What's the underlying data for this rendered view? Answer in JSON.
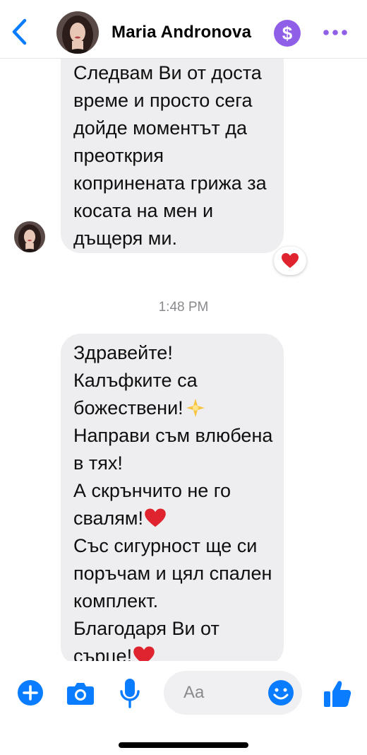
{
  "header": {
    "back_icon": "chevron-left-icon",
    "contact_name": "Maria Andronova",
    "badge_symbol": "$",
    "more_icon": "ellipsis-icon"
  },
  "messages": {
    "first": {
      "lines": [
        "Следвам Ви от доста",
        "време и просто сега",
        "дойде моментът да",
        "преоткрия",
        "копринената грижа за",
        "косата на мен и",
        "дъщеря ми."
      ],
      "reaction": "heart"
    },
    "timestamp": "1:48 PM",
    "second": {
      "lines": [
        "Здравейте!",
        "Калъфките са",
        "божествени!",
        "Направи съм влюбена",
        "в тях!",
        "А скрънчито не го",
        "свалям!",
        "Със сигурност ще си",
        "поръчам и цял спален",
        "комплект.",
        "Благодаря Ви от",
        "сърце!"
      ]
    }
  },
  "composer": {
    "placeholder": "Aa",
    "icons": [
      "plus-icon",
      "camera-icon",
      "microphone-icon",
      "emoji-icon",
      "thumbs-up-icon"
    ]
  },
  "colors": {
    "accent": "#0a7cff",
    "bubble": "#eeeef0",
    "badge": "#8f5fe8",
    "heart": "#e0242f"
  }
}
